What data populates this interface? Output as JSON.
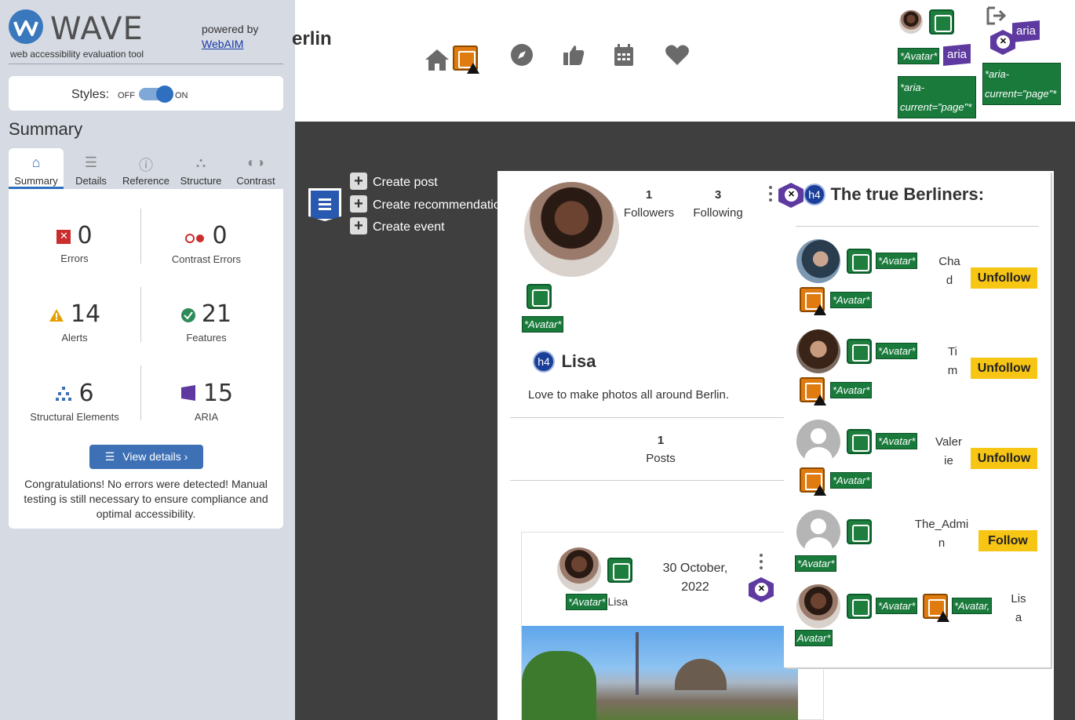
{
  "wave": {
    "title": "WAVE",
    "subtitle": "web accessibility evaluation tool",
    "powered_by": "powered by",
    "webaim_link": "WebAIM",
    "styles_label": "Styles:",
    "styles_off": "OFF",
    "styles_on": "ON",
    "summary_heading": "Summary",
    "tabs": [
      {
        "label": "Summary",
        "icon": "home-icon"
      },
      {
        "label": "Details",
        "icon": "list-icon"
      },
      {
        "label": "Reference",
        "icon": "info-icon"
      },
      {
        "label": "Structure",
        "icon": "hierarchy-icon"
      },
      {
        "label": "Contrast",
        "icon": "contrast-icon"
      }
    ],
    "stats": {
      "errors": {
        "value": "0",
        "label": "Errors"
      },
      "contrast_errors": {
        "value": "0",
        "label": "Contrast Errors"
      },
      "alerts": {
        "value": "14",
        "label": "Alerts"
      },
      "features": {
        "value": "21",
        "label": "Features"
      },
      "structural": {
        "value": "6",
        "label": "Structural Elements"
      },
      "aria": {
        "value": "15",
        "label": "ARIA"
      }
    },
    "view_details": "View details ›",
    "congrats": "Congratulations! No errors were detected! Manual testing is still necessary to ensure compliance and optimal accessibility.",
    "colors": {
      "accent": "#3d70b5",
      "error": "#cb2c2c",
      "alert": "#e5a000",
      "feature": "#2e8b57",
      "aria": "#5e3aa0"
    }
  },
  "site": {
    "brand": "erlin",
    "nav_icons": [
      "home-icon",
      "compass-icon",
      "thumbs-up-icon",
      "calendar-icon",
      "heart-icon"
    ],
    "header_labels": {
      "avatar": "*Avatar*",
      "aria": "aria",
      "aria_current_1": "*aria-current=\"page\"*",
      "aria_current_2": "*aria-current=\"page\"*"
    },
    "actions": [
      "Create post",
      "Create recommendation",
      "Create event"
    ],
    "profile": {
      "followers_count": "1",
      "followers_label": "Followers",
      "following_count": "3",
      "following_label": "Following",
      "avatar_label": "*Avatar*",
      "heading_tag": "h4",
      "name": "Lisa",
      "bio": "Love to make photos all around Berlin.",
      "posts_count": "1",
      "posts_label": "Posts"
    },
    "following_panel": {
      "heading_tag": "h4",
      "title": "The true Berliners:",
      "people": [
        {
          "name": "Chad",
          "button": "Unfollow",
          "label1": "*Avatar*",
          "label2": "*Avatar*"
        },
        {
          "name": "Tim",
          "button": "Unfollow",
          "label1": "*Avatar*",
          "label2": "*Avatar*"
        },
        {
          "name": "Valerie",
          "button": "Unfollow",
          "label1": "*Avatar*",
          "label2": "*Avatar*"
        },
        {
          "name": "The_Admin",
          "button": "Follow",
          "label1": "*Avatar*"
        },
        {
          "name": "Lisa",
          "label1": "*Avatar*",
          "label2": "*Avatar,",
          "label3": "Avatar*"
        }
      ]
    },
    "post": {
      "avatar_label": "*Avatar*",
      "author": "Lisa",
      "date": "30 October, 2022"
    }
  }
}
